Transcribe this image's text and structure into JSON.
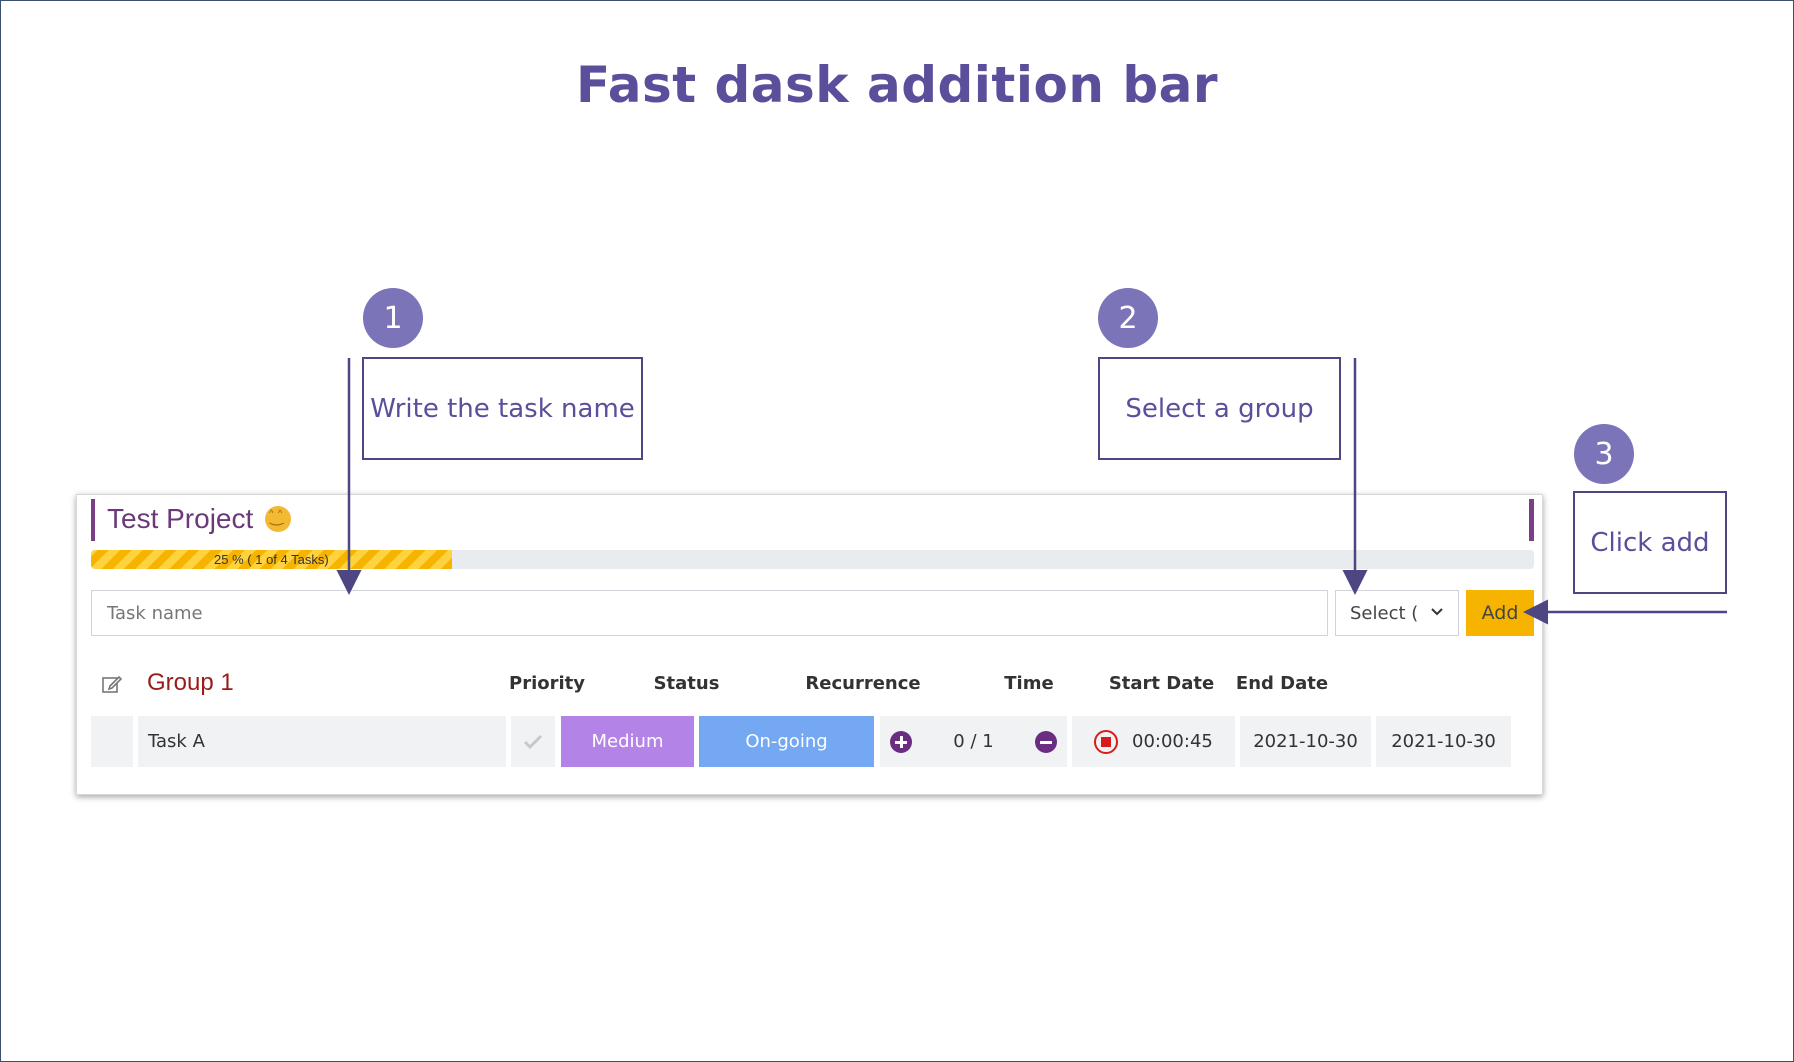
{
  "slide": {
    "title": "Fast dask addition bar",
    "steps": [
      {
        "number": "1",
        "text": "Write the task name"
      },
      {
        "number": "2",
        "text": "Select a group"
      },
      {
        "number": "3",
        "text": "Click add"
      }
    ]
  },
  "project": {
    "title": "Test Project",
    "progress": {
      "percent": 25,
      "label": "25 % ( 1 of 4 Tasks)"
    }
  },
  "add_bar": {
    "task_placeholder": "Task name",
    "group_select": "Select (",
    "add_label": "Add"
  },
  "table": {
    "group_name": "Group 1",
    "columns": [
      "Priority",
      "Status",
      "Recurrence",
      "Time",
      "Start Date",
      "End Date"
    ],
    "rows": [
      {
        "task": "Task A",
        "priority": "Medium",
        "status": "On-going",
        "recurrence": "0 / 1",
        "time": "00:00:45",
        "start_date": "2021-10-30",
        "end_date": "2021-10-30"
      }
    ]
  },
  "colors": {
    "title": "#5b4f9c",
    "badge": "#7b74b8",
    "accent_yellow": "#f6b400",
    "priority_medium": "#b483e8",
    "status_ongoing": "#74a8f2",
    "group_name": "#9b1b1b"
  }
}
